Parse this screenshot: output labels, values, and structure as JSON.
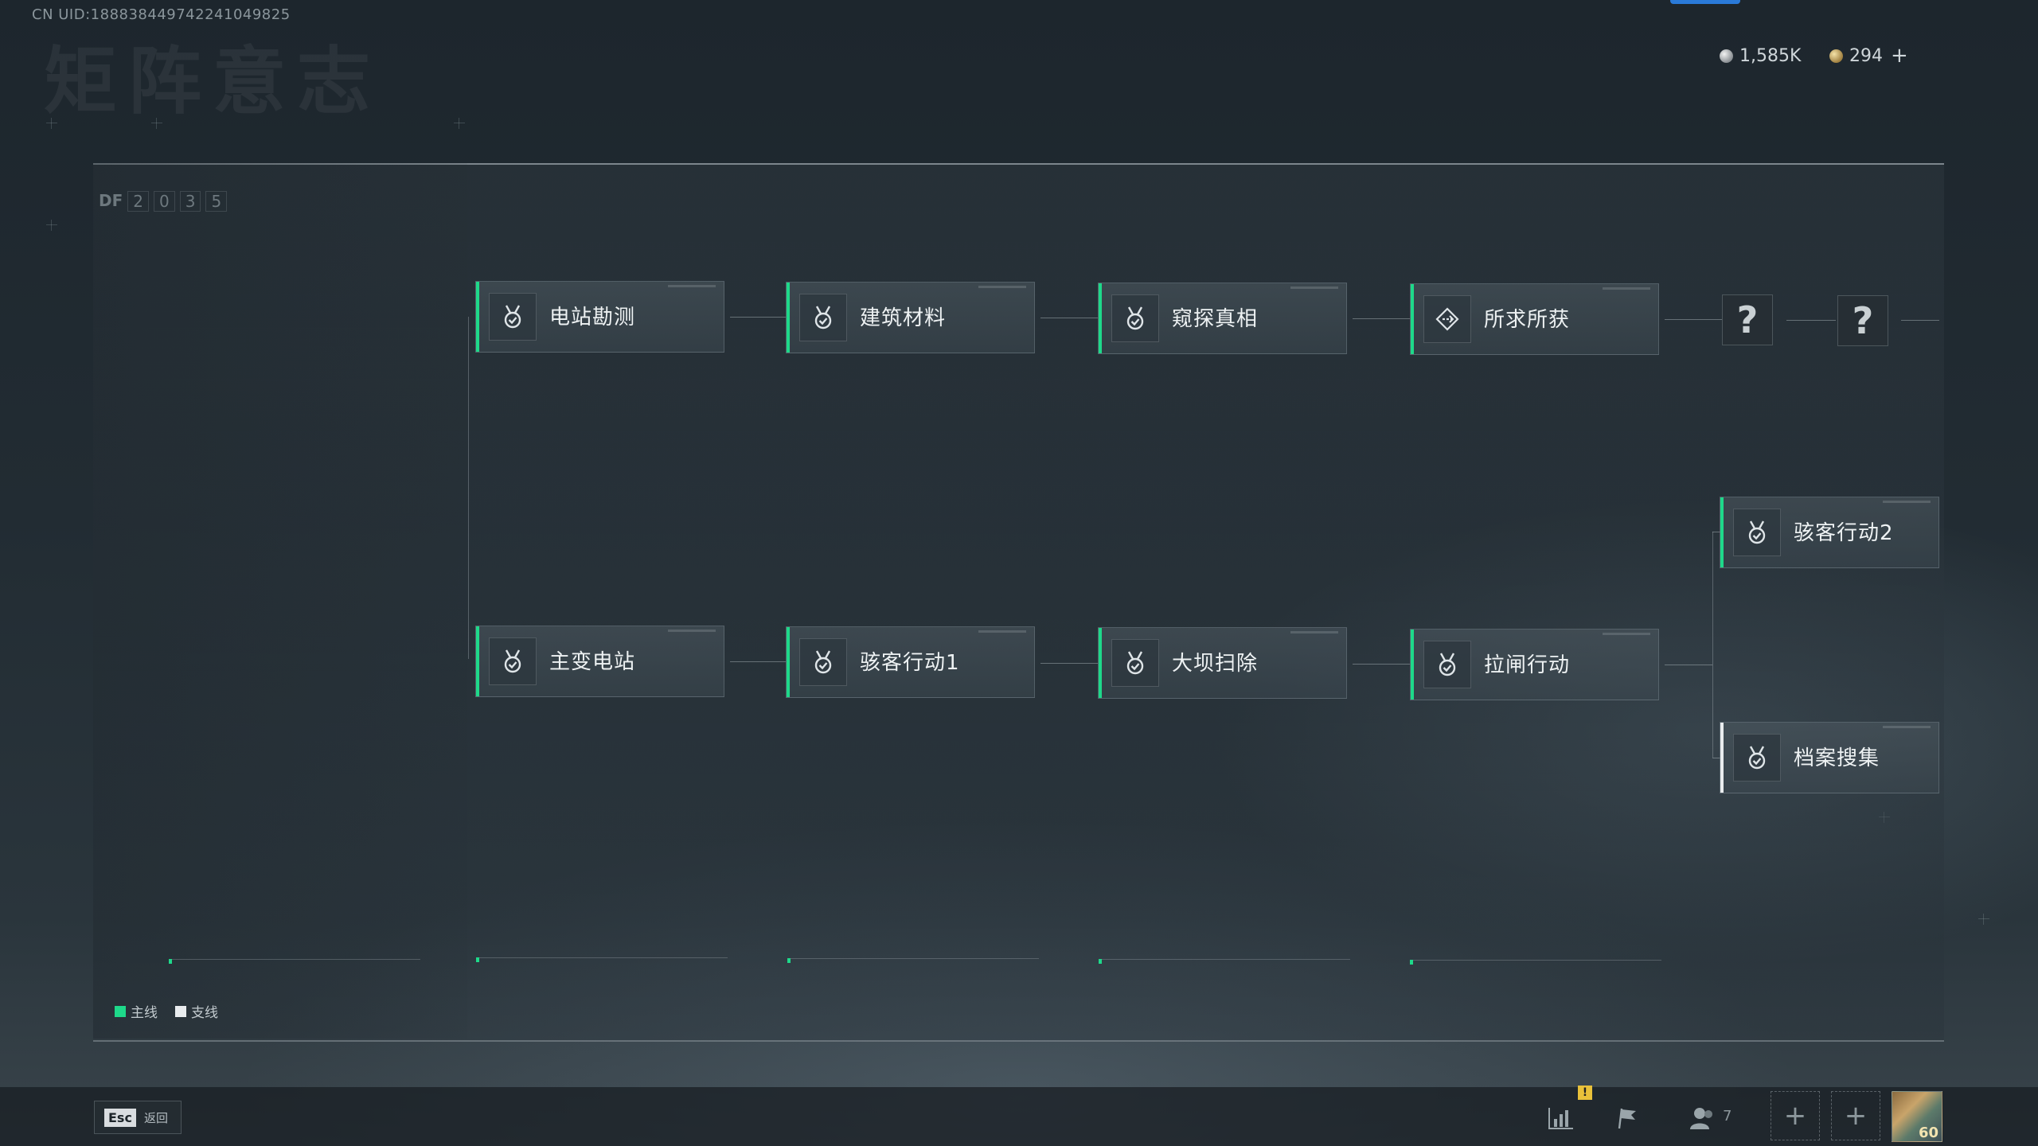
{
  "header": {
    "uid": "CN UID:18883844974224104982​5",
    "currency": [
      {
        "icon": "silver-coin-icon",
        "value": "1,585K"
      },
      {
        "icon": "gold-coin-icon",
        "value": "294"
      }
    ],
    "add_label": "+"
  },
  "panel": {
    "code_label": "DF",
    "code_digits": [
      "2",
      "0",
      "3",
      "5"
    ]
  },
  "missions": {
    "row1": [
      "电站勘测",
      "建筑材料",
      "窥探真相",
      "所求所获"
    ],
    "unknown": [
      "?",
      "?"
    ],
    "row2": [
      "主变电站",
      "骇客行动1",
      "大坝扫除",
      "拉闸行动"
    ],
    "branch": [
      "骇客行动2",
      "档案搜集"
    ]
  },
  "legend": {
    "main": "主线",
    "side": "支线",
    "colors": {
      "main": "#1ed98a",
      "side": "#e9ecee"
    }
  },
  "footer": {
    "esc_key": "Esc",
    "esc_label": "返回",
    "alert": "!",
    "friends_count": "7",
    "add_slot": "+",
    "avatar_level": "60"
  }
}
